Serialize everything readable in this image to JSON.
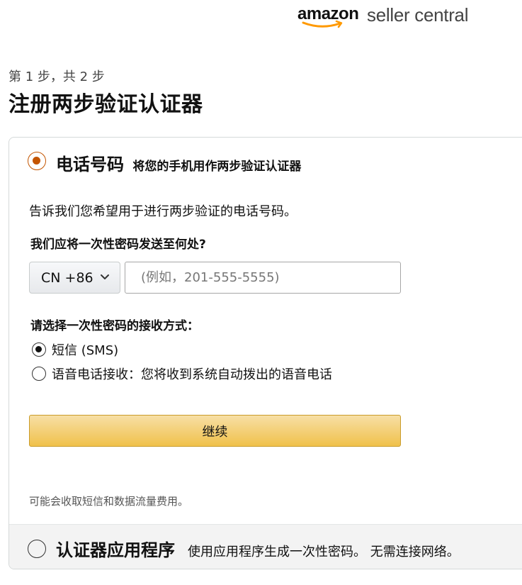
{
  "logo": {
    "brand": "amazon",
    "product": "seller central"
  },
  "header": {
    "step": "第 1 步，共 2 步",
    "title": "注册两步验证认证器"
  },
  "phone_option": {
    "title": "电话号码",
    "subtitle": "将您的手机用作两步验证认证器",
    "selected": true,
    "description": "告诉我们您希望用于进行两步验证的电话号码。",
    "destination_label": "我们应将一次性密码发送至何处?",
    "country_code": "CN +86",
    "phone_placeholder": "(例如，201-555-5555)",
    "phone_value": "",
    "method_label": "请选择一次性密码的接收方式：",
    "methods": [
      {
        "label": "短信 (SMS)",
        "selected": true
      },
      {
        "label": "语音电话接收：您将收到系统自动拨出的语音电话",
        "selected": false
      }
    ],
    "continue_label": "继续",
    "fee_note": "可能会收取短信和数据流量费用。"
  },
  "app_option": {
    "title": "认证器应用程序",
    "subtitle": "使用应用程序生成一次性密码。 无需连接网络。",
    "selected": false
  },
  "colors": {
    "accent": "#c45500",
    "button_top": "#f7dfa5",
    "button_bottom": "#f0c14b",
    "logo_smile": "#ff9900"
  }
}
